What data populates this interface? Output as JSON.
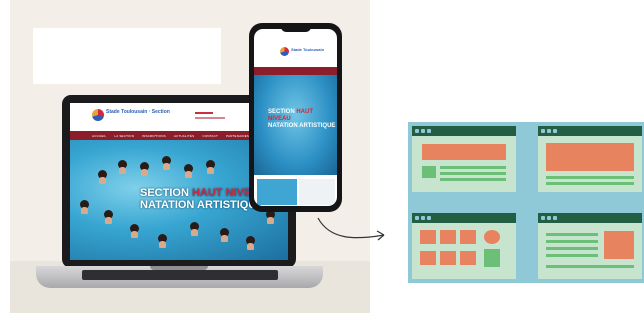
{
  "laptop_site": {
    "logo_text": "Stade Toulousain · Section",
    "nav_items": [
      "ACCUEIL",
      "LA SECTION",
      "INSCRIPTIONS",
      "ACTUALITÉS",
      "CONTACT",
      "PARTENAIRES"
    ],
    "hero_line1": "SECTION",
    "hero_accent": "HAUT NIVEAU",
    "hero_line2": "NATATION ARTISTIQUE"
  },
  "phone_site": {
    "logo_text": "Stade Toulousain",
    "hero_line1": "SECTION",
    "hero_accent": "HAUT NIVEAU",
    "hero_line2": "NATATION ARTISTIQUE"
  },
  "colors": {
    "brand_red": "#8c1d2b",
    "accent_red": "#d3253a",
    "pool_blue": "#38a6d2",
    "wireframe_bg": "#8fc9d7",
    "wireframe_bar": "#235d43",
    "wireframe_block": "#e8835f",
    "wireframe_line": "#6bbf76"
  },
  "icons": [
    "arrow-icon"
  ]
}
